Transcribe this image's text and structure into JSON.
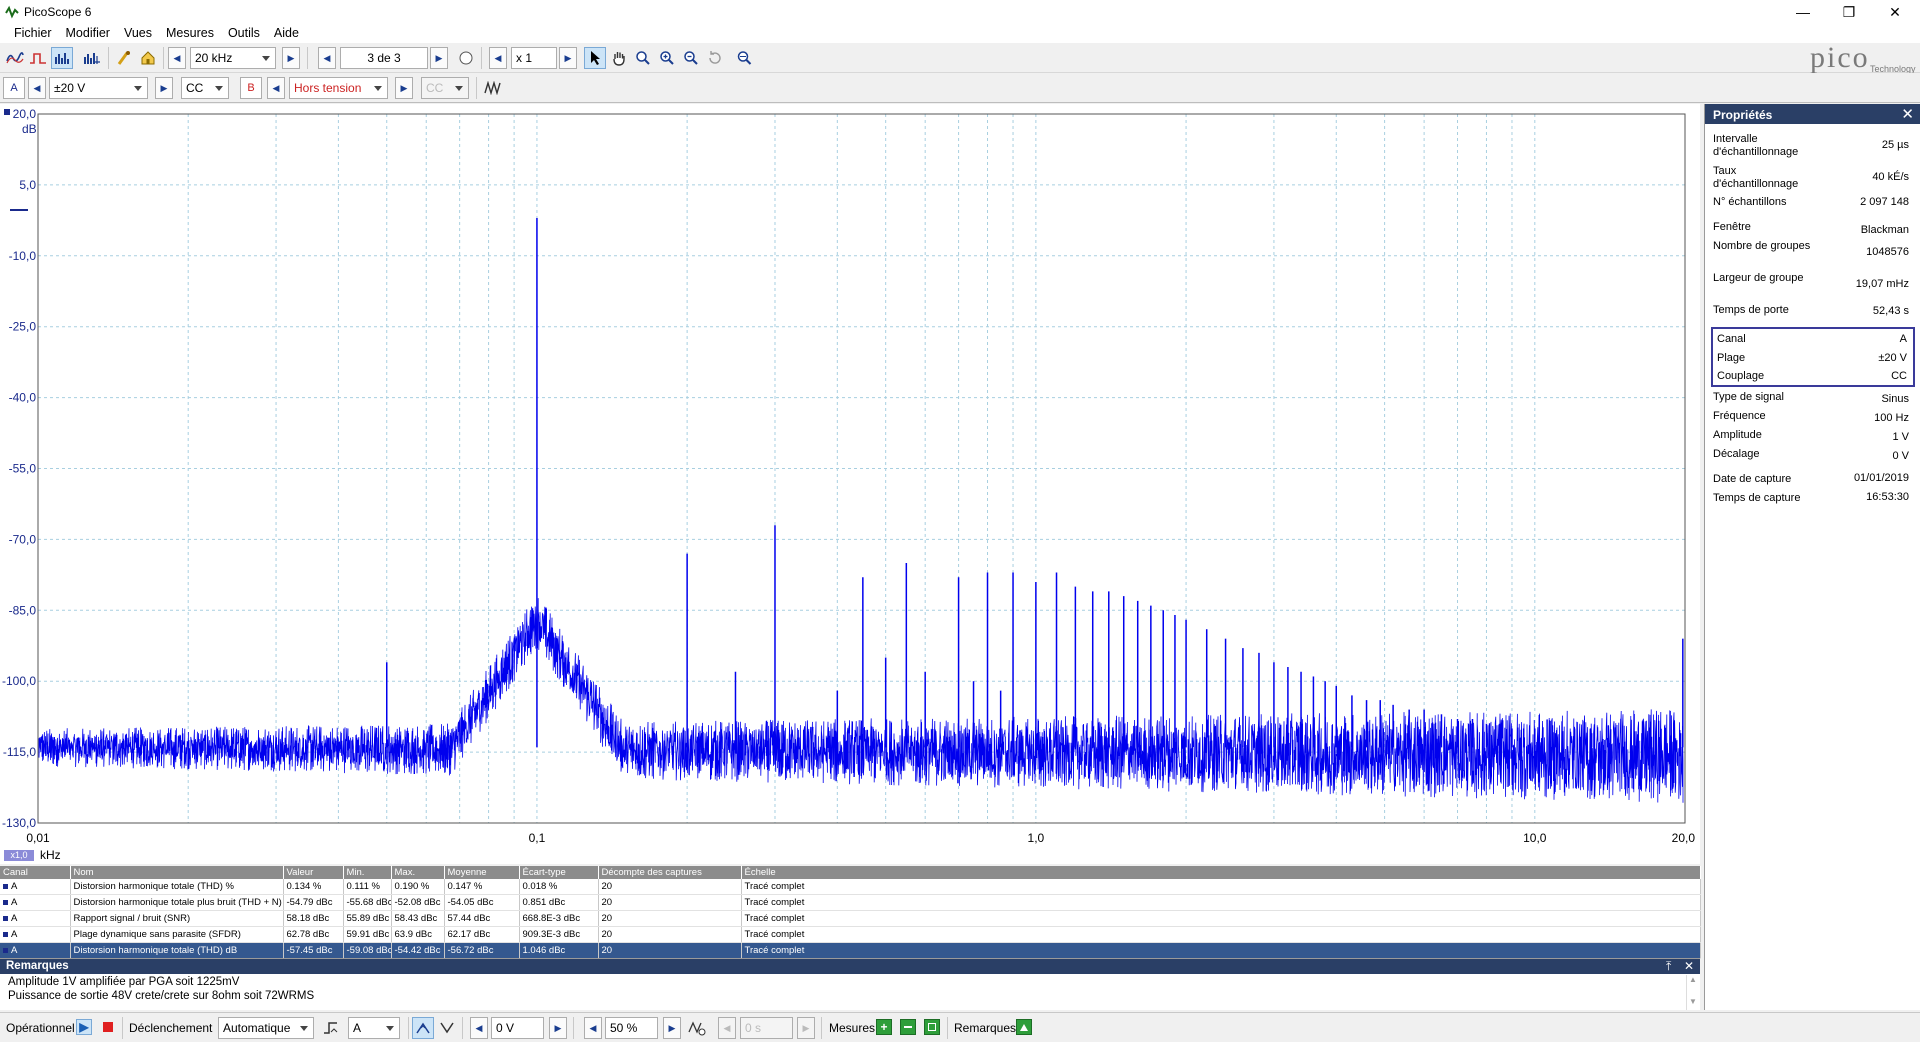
{
  "window": {
    "title": "PicoScope 6",
    "minimize_icon": "minimize-icon",
    "maximize_icon": "restore-icon",
    "close_icon": "close-icon"
  },
  "menu": [
    "Fichier",
    "Modifier",
    "Vues",
    "Mesures",
    "Outils",
    "Aide"
  ],
  "toolbar": {
    "timebase": "20 kHz",
    "capture_counter": "3 de 3",
    "zoom": "x 1",
    "channel_a_label": "A",
    "channel_a_range": "±20 V",
    "channel_a_coupling": "CC",
    "channel_b_label": "B",
    "channel_b_range": "Hors tension",
    "channel_b_coupling": "CC",
    "logo_text": "pico",
    "logo_subtext": "Technology",
    "icons": [
      "scope-mode-icon",
      "persistence-mode-icon",
      "spectrum-mode-icon",
      "spectrum-view-icon",
      "probe-icon",
      "home-icon",
      "prev-icon",
      "next-icon",
      "compass-icon",
      "pointer-icon",
      "hand-icon",
      "zoom-in-icon",
      "zoom-in-region-icon",
      "zoom-out-icon",
      "undo-zoom-icon",
      "zoom-fit-icon",
      "signal-generator-icon"
    ]
  },
  "chart_data": {
    "type": "line",
    "x_scale": "log",
    "x_unit": "kHz",
    "y_unit": "dB",
    "xlim": [
      0.01,
      20.0
    ],
    "ylim": [
      -130,
      20
    ],
    "y_ticks": [
      "20,0",
      "5,0",
      "-10,0",
      "-25,0",
      "-40,0",
      "-55,0",
      "-70,0",
      "-85,0",
      "-100,0",
      "-115,0",
      "-130,0"
    ],
    "x_tick_labels": [
      "0,01",
      "0,1",
      "1,0",
      "10,0",
      "20,0"
    ],
    "x_tick_values": [
      0.01,
      0.1,
      1.0,
      10.0,
      20.0
    ],
    "scale_badge": "x1,0",
    "grid": true,
    "noise_floor": -116,
    "series": [
      {
        "color": "#0000ee",
        "peaks": [
          {
            "x": 0.05,
            "y": -96
          },
          {
            "x": 0.1,
            "y": -2
          },
          {
            "x": 0.2,
            "y": -73
          },
          {
            "x": 0.25,
            "y": -98
          },
          {
            "x": 0.3,
            "y": -67
          },
          {
            "x": 0.4,
            "y": -102
          },
          {
            "x": 0.45,
            "y": -78
          },
          {
            "x": 0.5,
            "y": -95
          },
          {
            "x": 0.55,
            "y": -75
          },
          {
            "x": 0.6,
            "y": -98
          },
          {
            "x": 0.7,
            "y": -78
          },
          {
            "x": 0.75,
            "y": -100
          },
          {
            "x": 0.8,
            "y": -77
          },
          {
            "x": 0.85,
            "y": -102
          },
          {
            "x": 0.9,
            "y": -77
          },
          {
            "x": 1.0,
            "y": -79
          },
          {
            "x": 1.1,
            "y": -77
          },
          {
            "x": 1.2,
            "y": -80
          },
          {
            "x": 1.3,
            "y": -81
          },
          {
            "x": 1.4,
            "y": -81
          },
          {
            "x": 1.5,
            "y": -82
          },
          {
            "x": 1.6,
            "y": -83
          },
          {
            "x": 1.7,
            "y": -84
          },
          {
            "x": 1.8,
            "y": -85
          },
          {
            "x": 1.9,
            "y": -86
          },
          {
            "x": 2.0,
            "y": -87
          },
          {
            "x": 2.2,
            "y": -89
          },
          {
            "x": 2.4,
            "y": -91
          },
          {
            "x": 2.6,
            "y": -93
          },
          {
            "x": 2.8,
            "y": -94
          },
          {
            "x": 3.0,
            "y": -96
          },
          {
            "x": 3.2,
            "y": -97
          },
          {
            "x": 3.4,
            "y": -98
          },
          {
            "x": 3.6,
            "y": -99
          },
          {
            "x": 3.8,
            "y": -100
          },
          {
            "x": 4.0,
            "y": -101
          },
          {
            "x": 4.3,
            "y": -103
          },
          {
            "x": 4.6,
            "y": -104
          },
          {
            "x": 4.9,
            "y": -104
          },
          {
            "x": 5.2,
            "y": -105
          },
          {
            "x": 5.6,
            "y": -106
          },
          {
            "x": 6.0,
            "y": -106
          },
          {
            "x": 6.5,
            "y": -107
          },
          {
            "x": 7.0,
            "y": -108
          },
          {
            "x": 7.5,
            "y": -108
          },
          {
            "x": 8.0,
            "y": -109
          },
          {
            "x": 8.5,
            "y": -109
          },
          {
            "x": 9.0,
            "y": -110
          },
          {
            "x": 9.5,
            "y": -110
          },
          {
            "x": 10.0,
            "y": -110
          },
          {
            "x": 11.0,
            "y": -111
          },
          {
            "x": 12.0,
            "y": -111
          },
          {
            "x": 13.0,
            "y": -111
          },
          {
            "x": 14.0,
            "y": -112
          },
          {
            "x": 17.0,
            "y": -111
          },
          {
            "x": 19.6,
            "y": -111
          },
          {
            "x": 19.8,
            "y": -91
          }
        ]
      }
    ]
  },
  "properties": {
    "title": "Propriétés",
    "close_icon": "close-icon",
    "rows": [
      {
        "label": "Intervalle d'échantillonnage",
        "value": "25 µs"
      },
      {
        "label": "Taux d'échantillonnage",
        "value": "40 kÉ/s"
      },
      {
        "label": "N° échantillons",
        "value": "2 097 148"
      },
      {
        "label": "Fenêtre",
        "value": "Blackman"
      },
      {
        "label": "Nombre de groupes",
        "value": "1048576"
      },
      {
        "label": "Largeur de groupe",
        "value": "19,07 mHz"
      },
      {
        "label": "Temps de porte",
        "value": "52,43 s"
      }
    ],
    "channel_rows": [
      {
        "label": "Canal",
        "value": "A"
      },
      {
        "label": "Plage",
        "value": "±20 V"
      },
      {
        "label": "Couplage",
        "value": "CC"
      }
    ],
    "signal_rows": [
      {
        "label": "Type de signal",
        "value": "Sinus"
      },
      {
        "label": "Fréquence",
        "value": "100 Hz"
      },
      {
        "label": "Amplitude",
        "value": "1 V"
      },
      {
        "label": "Décalage",
        "value": "0 V"
      }
    ],
    "capture_rows": [
      {
        "label": "Date de capture",
        "value": "01/01/2019"
      },
      {
        "label": "Temps de capture",
        "value": "16:53:30"
      }
    ]
  },
  "measurements": {
    "columns": [
      "Canal",
      "Nom",
      "Valeur",
      "Min.",
      "Max.",
      "Moyenne",
      "Écart-type",
      "Décompte des captures",
      "Échelle"
    ],
    "rows": [
      [
        "A",
        "Distorsion harmonique totale (THD) %",
        "0.134 %",
        "0.111 %",
        "0.190 %",
        "0.147 %",
        "0.018 %",
        "20",
        "Tracé complet"
      ],
      [
        "A",
        "Distorsion harmonique totale plus bruit (THD + N)",
        "-54.79 dBc",
        "-55.68 dBc",
        "-52.08 dBc",
        "-54.05 dBc",
        "0.851 dBc",
        "20",
        "Tracé complet"
      ],
      [
        "A",
        "Rapport signal / bruit (SNR)",
        "58.18 dBc",
        "55.89 dBc",
        "58.43 dBc",
        "57.44 dBc",
        "668.8E-3 dBc",
        "20",
        "Tracé complet"
      ],
      [
        "A",
        "Plage dynamique sans parasite (SFDR)",
        "62.78 dBc",
        "59.91 dBc",
        "63.9 dBc",
        "62.17 dBc",
        "909.3E-3 dBc",
        "20",
        "Tracé complet"
      ],
      [
        "A",
        "Distorsion harmonique totale (THD) dB",
        "-57.45 dBc",
        "-59.08 dBc",
        "-54.42 dBc",
        "-56.72 dBc",
        "1.046 dBc",
        "20",
        "Tracé complet"
      ]
    ],
    "selected_row": 4
  },
  "remarks": {
    "title": "Remarques",
    "lines": [
      "Amplitude 1V amplifiée par PGA soit 1225mV",
      "Puissance de sortie 48V crete/crete sur 8ohm soit 72WRMS"
    ]
  },
  "statusbar": {
    "state": "Opérationnel",
    "trigger_label": "Déclenchement",
    "trigger_mode": "Automatique",
    "trigger_channel": "A",
    "trigger_level": "0 V",
    "pretrigger": "50 %",
    "delay": "0 s",
    "measures_label": "Mesures",
    "remarks_label": "Remarques"
  },
  "colors": {
    "accent": "#2a3f66",
    "trace": "#0000ee",
    "grid": "#a8cfe0",
    "selected_row": "#34588f",
    "channel_a": "#1a2a8c",
    "channel_b": "#cc2222"
  }
}
